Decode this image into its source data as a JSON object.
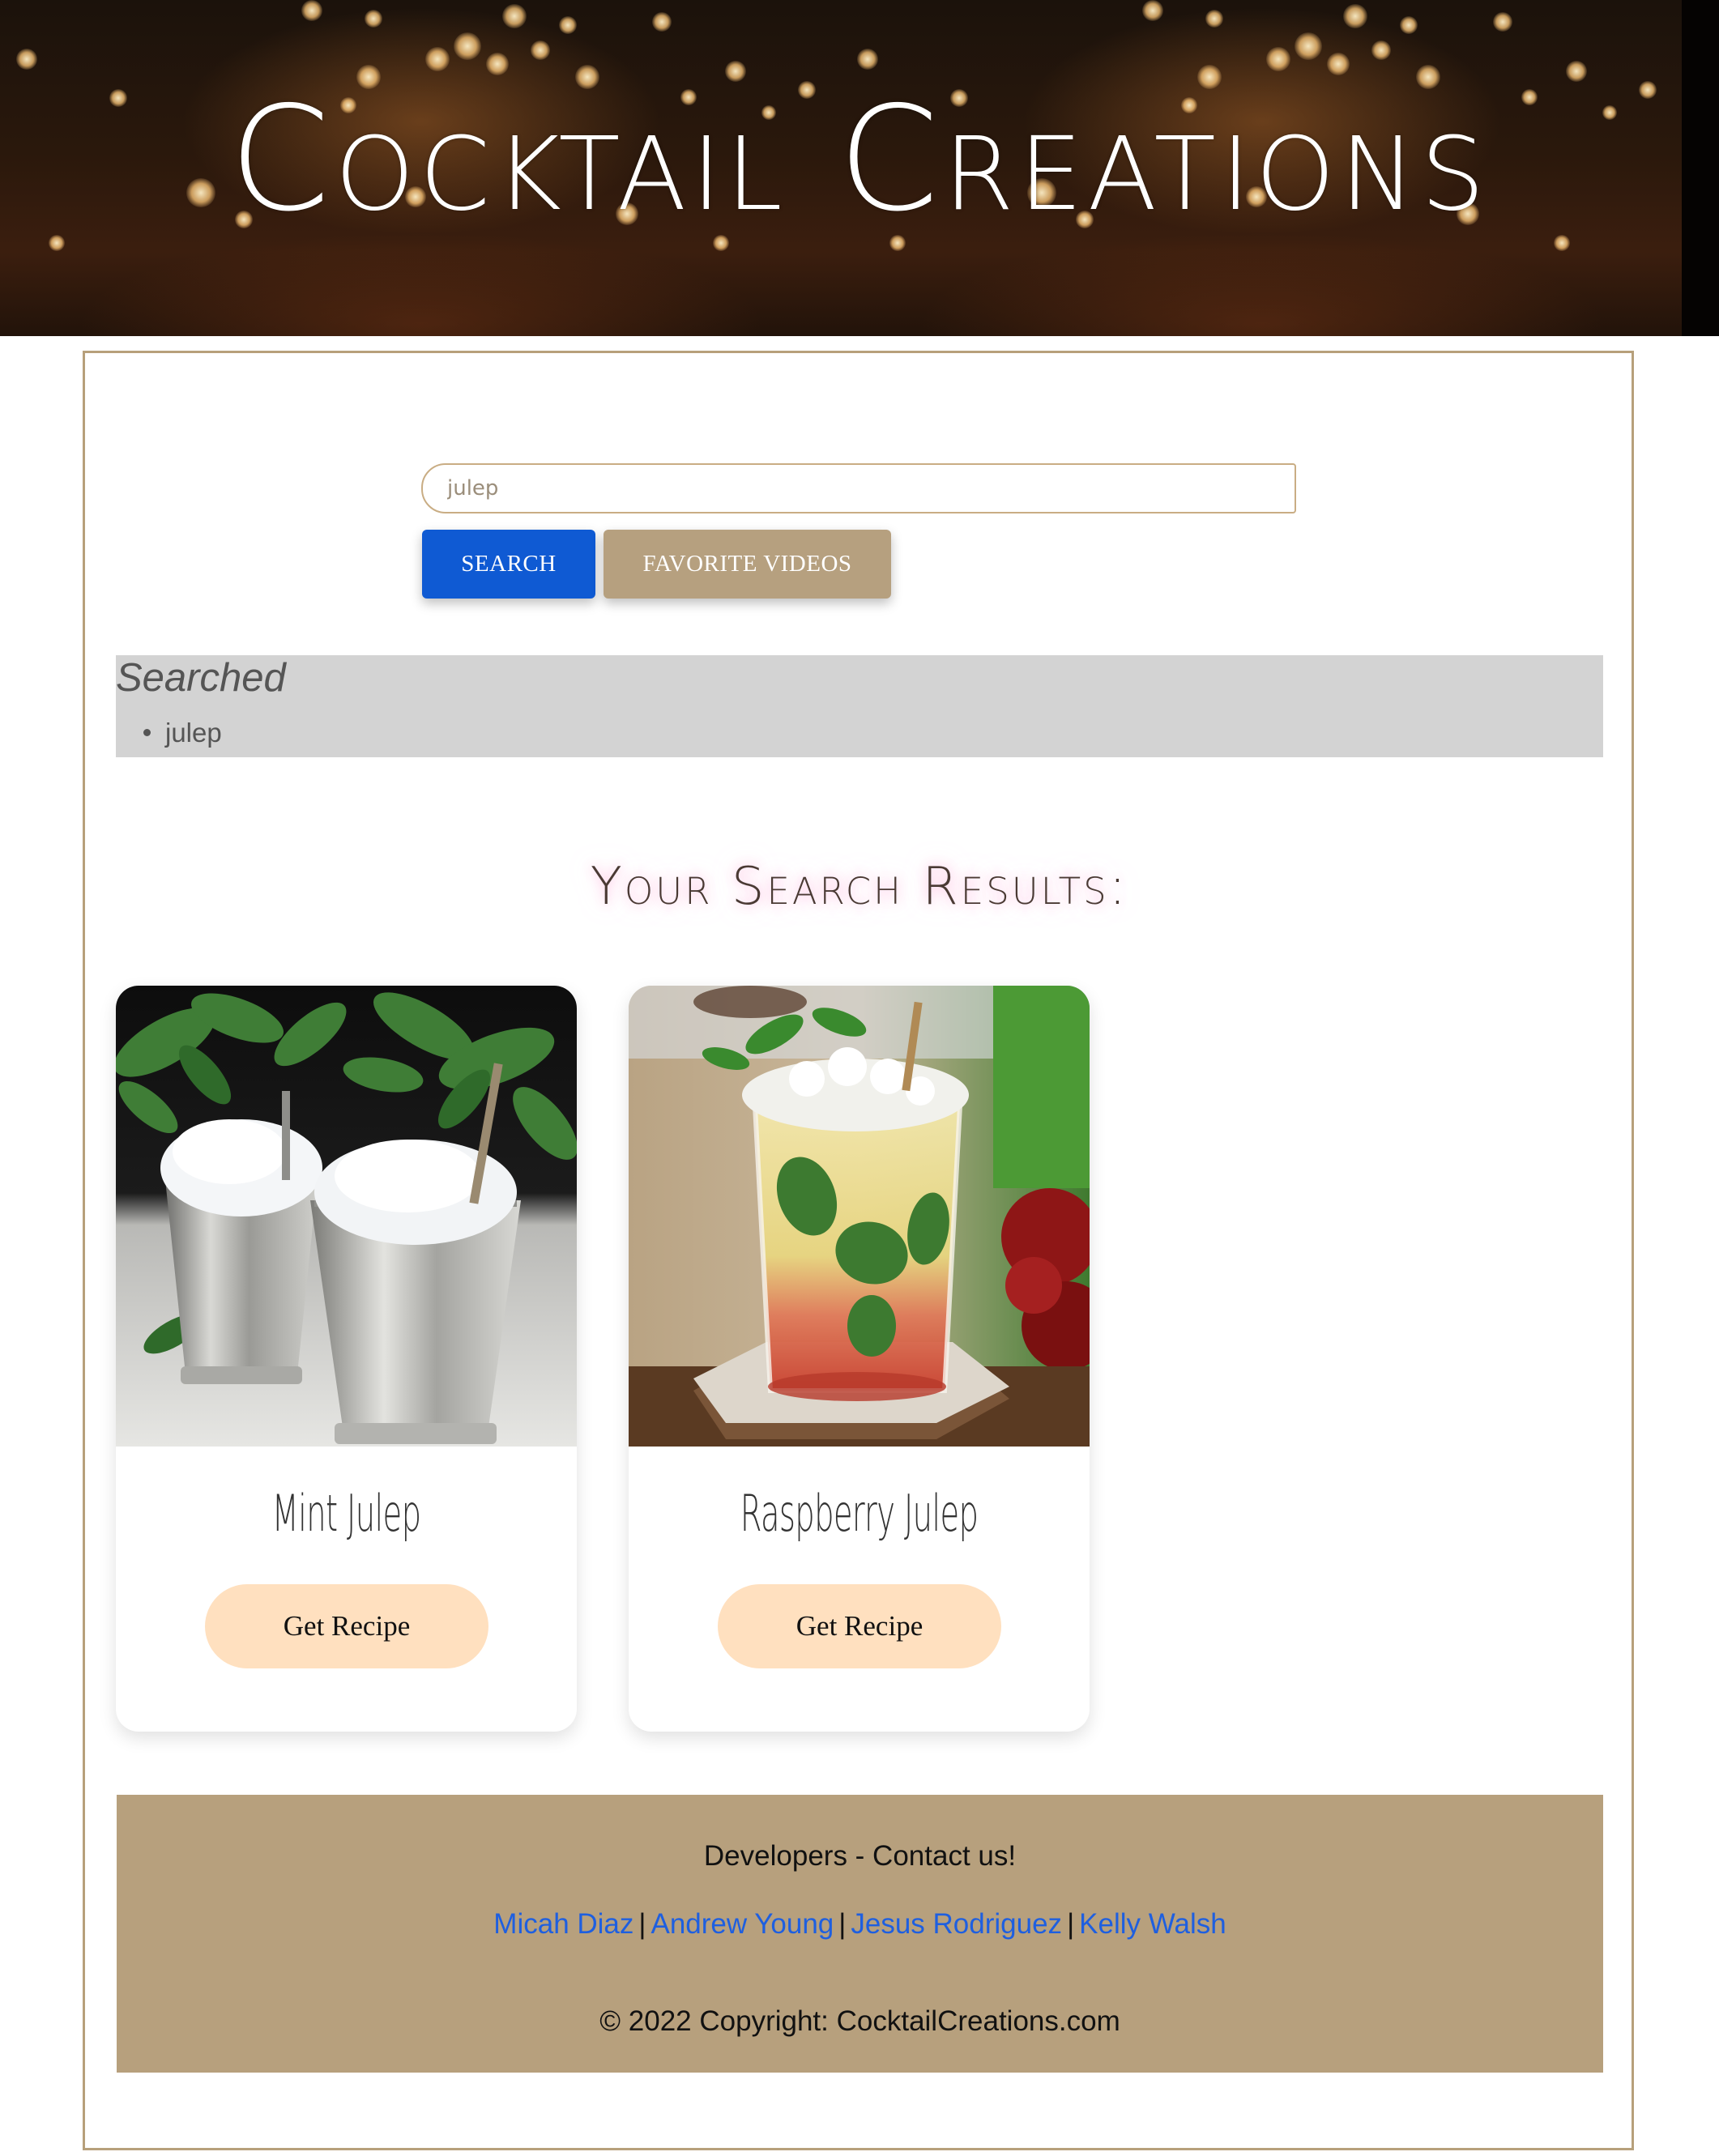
{
  "hero": {
    "title": "Cocktail Creations"
  },
  "search": {
    "value": "julep",
    "search_label": "SEARCH",
    "favorites_label": "FAVORITE VIDEOS"
  },
  "searched": {
    "title": "Searched",
    "items": [
      "julep"
    ]
  },
  "results": {
    "heading": "Your Search Results:",
    "cards": [
      {
        "name": "Mint Julep",
        "button_label": "Get Recipe"
      },
      {
        "name": "Raspberry Julep",
        "button_label": "Get Recipe"
      }
    ]
  },
  "footer": {
    "contact": "Developers - Contact us!",
    "developers": [
      "Micah Diaz",
      "Andrew Young",
      "Jesus Rodriguez",
      "Kelly Walsh"
    ],
    "copyright": "© 2022 Copyright: CocktailCreations.com"
  },
  "colors": {
    "search_button": "#0f5ad3",
    "favorite_button": "#b6a07f",
    "recipe_button": "#ffe0bf",
    "footer_bg": "#b7a07d",
    "link": "#1e5fe0",
    "frame_border": "#b7a07b"
  }
}
